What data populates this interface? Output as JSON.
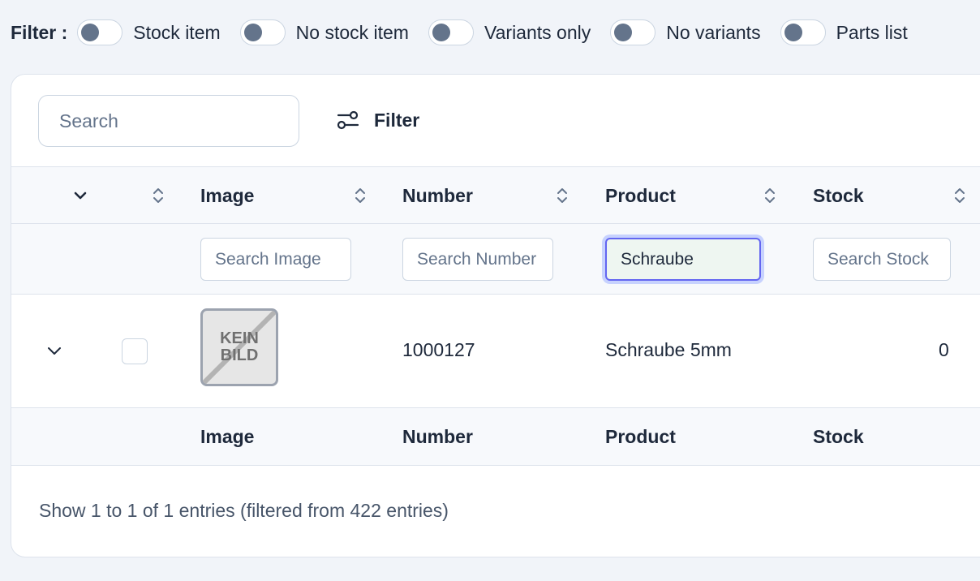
{
  "filterbar": {
    "label": "Filter :",
    "toggles": [
      {
        "label": "Stock item",
        "on": false
      },
      {
        "label": "No stock item",
        "on": false
      },
      {
        "label": "Variants only",
        "on": false
      },
      {
        "label": "No variants",
        "on": false
      },
      {
        "label": "Parts list",
        "on": false
      }
    ]
  },
  "toolbar": {
    "search_placeholder": "Search",
    "filter_label": "Filter"
  },
  "table": {
    "headers": {
      "image": "Image",
      "number": "Number",
      "product": "Product",
      "stock": "Stock"
    },
    "column_search": {
      "image_placeholder": "Search Image",
      "number_placeholder": "Search Number",
      "product_value": "Schraube",
      "stock_placeholder": "Search Stock"
    },
    "rows": [
      {
        "image_text_1": "KEIN",
        "image_text_2": "BILD",
        "number": "1000127",
        "product": "Schraube 5mm",
        "stock": "0",
        "selected": false
      }
    ],
    "footer": {
      "image": "Image",
      "number": "Number",
      "product": "Product",
      "stock": "Stock"
    }
  },
  "status": "Show 1 to 1 of 1 entries (filtered from 422 entries)",
  "colors": {
    "background": "#f1f4f9",
    "accent": "#6366f1",
    "toggle_knob": "#64748b"
  }
}
